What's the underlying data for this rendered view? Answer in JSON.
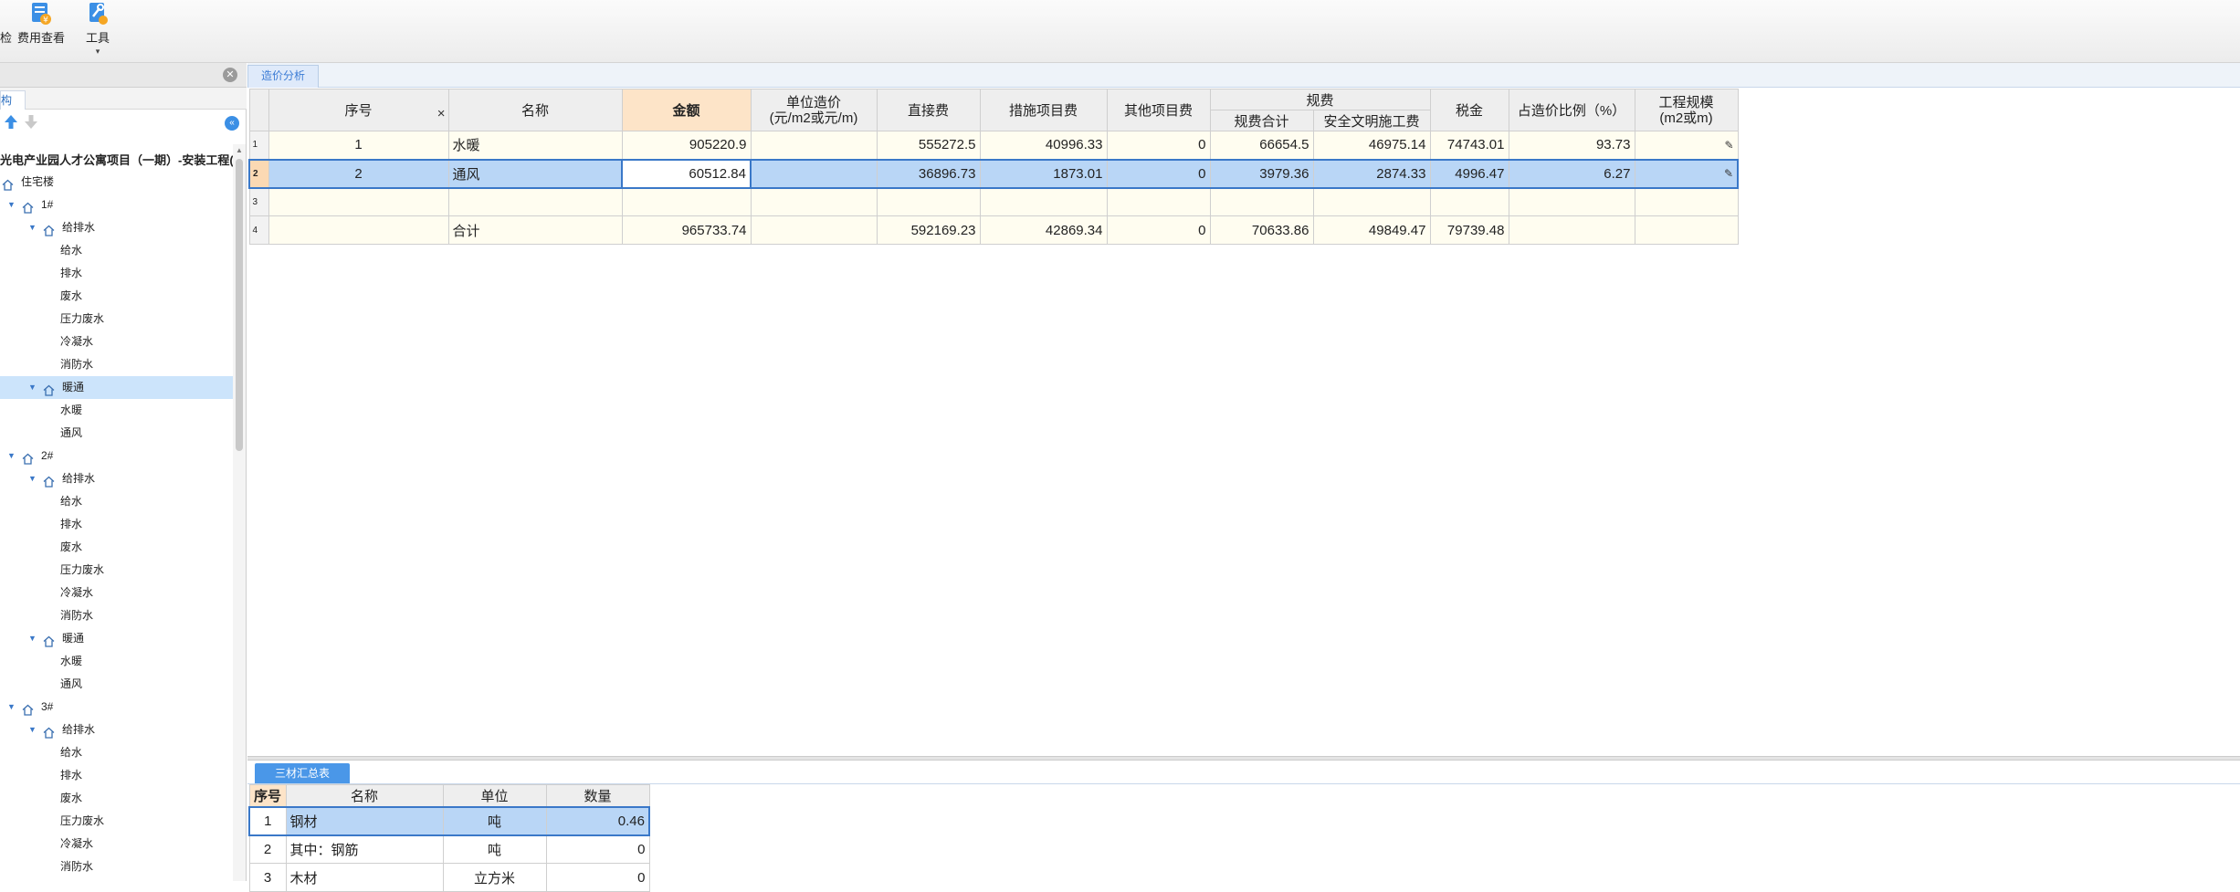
{
  "toolbar": {
    "check_label": "检",
    "fee_view_label": "费用查看",
    "tools_label": "工具"
  },
  "left_panel": {
    "tab_label": "构",
    "tree_title": "光电产业园人才公寓项目（一期）-安装工程(...",
    "tree": [
      {
        "label": "住宅楼",
        "depth": 0,
        "toggle": false
      },
      {
        "label": "1#",
        "depth": 1,
        "toggle": true
      },
      {
        "label": "给排水",
        "depth": 2,
        "toggle": true
      },
      {
        "label": "给水",
        "depth": 3,
        "toggle": false
      },
      {
        "label": "排水",
        "depth": 3,
        "toggle": false
      },
      {
        "label": "废水",
        "depth": 3,
        "toggle": false
      },
      {
        "label": "压力废水",
        "depth": 3,
        "toggle": false
      },
      {
        "label": "冷凝水",
        "depth": 3,
        "toggle": false
      },
      {
        "label": "消防水",
        "depth": 3,
        "toggle": false
      },
      {
        "label": "暖通",
        "depth": 2,
        "toggle": true,
        "selected": true
      },
      {
        "label": "水暖",
        "depth": 3,
        "toggle": false
      },
      {
        "label": "通风",
        "depth": 3,
        "toggle": false
      },
      {
        "label": "2#",
        "depth": 1,
        "toggle": true
      },
      {
        "label": "给排水",
        "depth": 2,
        "toggle": true
      },
      {
        "label": "给水",
        "depth": 3,
        "toggle": false
      },
      {
        "label": "排水",
        "depth": 3,
        "toggle": false
      },
      {
        "label": "废水",
        "depth": 3,
        "toggle": false
      },
      {
        "label": "压力废水",
        "depth": 3,
        "toggle": false
      },
      {
        "label": "冷凝水",
        "depth": 3,
        "toggle": false
      },
      {
        "label": "消防水",
        "depth": 3,
        "toggle": false
      },
      {
        "label": "暖通",
        "depth": 2,
        "toggle": true
      },
      {
        "label": "水暖",
        "depth": 3,
        "toggle": false
      },
      {
        "label": "通风",
        "depth": 3,
        "toggle": false
      },
      {
        "label": "3#",
        "depth": 1,
        "toggle": true
      },
      {
        "label": "给排水",
        "depth": 2,
        "toggle": true
      },
      {
        "label": "给水",
        "depth": 3,
        "toggle": false
      },
      {
        "label": "排水",
        "depth": 3,
        "toggle": false
      },
      {
        "label": "废水",
        "depth": 3,
        "toggle": false
      },
      {
        "label": "压力废水",
        "depth": 3,
        "toggle": false
      },
      {
        "label": "冷凝水",
        "depth": 3,
        "toggle": false
      },
      {
        "label": "消防水",
        "depth": 3,
        "toggle": false
      }
    ]
  },
  "main": {
    "tab_label": "造价分析",
    "cost_table": {
      "headers": {
        "seq": "序号",
        "name": "名称",
        "amount": "金额",
        "unit_cost_line1": "单位造价",
        "unit_cost_line2": "(元/m2或元/m)",
        "direct": "直接费",
        "measures": "措施项目费",
        "other": "其他项目费",
        "regulation": "规费",
        "reg_total": "规费合计",
        "safety": "安全文明施工费",
        "tax": "税金",
        "ratio": "占造价比例（%）",
        "scale_line1": "工程规模",
        "scale_line2": "(m2或m)",
        "x_mark": "×"
      },
      "rows": [
        {
          "row": "1",
          "seq": "1",
          "name": "水暖",
          "amount": "905220.9",
          "unit_cost": "",
          "direct": "555272.5",
          "measures": "40996.33",
          "other": "0",
          "reg_total": "66654.5",
          "safety": "46975.14",
          "tax": "74743.01",
          "ratio": "93.73",
          "scale": "",
          "edit": "✎"
        },
        {
          "row": "2",
          "seq": "2",
          "name": "通风",
          "amount": "60512.84",
          "unit_cost": "",
          "direct": "36896.73",
          "measures": "1873.01",
          "other": "0",
          "reg_total": "3979.36",
          "safety": "2874.33",
          "tax": "4996.47",
          "ratio": "6.27",
          "scale": "",
          "edit": "✎"
        },
        {
          "row": "3",
          "seq": "",
          "name": "",
          "amount": "",
          "unit_cost": "",
          "direct": "",
          "measures": "",
          "other": "",
          "reg_total": "",
          "safety": "",
          "tax": "",
          "ratio": "",
          "scale": "",
          "edit": ""
        },
        {
          "row": "4",
          "seq": "",
          "name": "合计",
          "amount": "965733.74",
          "unit_cost": "",
          "direct": "592169.23",
          "measures": "42869.34",
          "other": "0",
          "reg_total": "70633.86",
          "safety": "49849.47",
          "tax": "79739.48",
          "ratio": "",
          "scale": "",
          "edit": ""
        }
      ]
    }
  },
  "bottom": {
    "tab_label": "三材汇总表",
    "headers": {
      "seq": "序号",
      "name": "名称",
      "unit": "单位",
      "qty": "数量"
    },
    "rows": [
      {
        "seq": "1",
        "name": "钢材",
        "unit": "吨",
        "qty": "0.46"
      },
      {
        "seq": "2",
        "name": "其中：钢筋",
        "unit": "吨",
        "qty": "0"
      },
      {
        "seq": "3",
        "name": "木材",
        "unit": "立方米",
        "qty": "0"
      }
    ]
  },
  "colors": {
    "accent": "#3a78c8",
    "selected_row": "#b9d6f6",
    "highlight_header": "#fde4c8",
    "tab_blue": "#4a97e8"
  }
}
